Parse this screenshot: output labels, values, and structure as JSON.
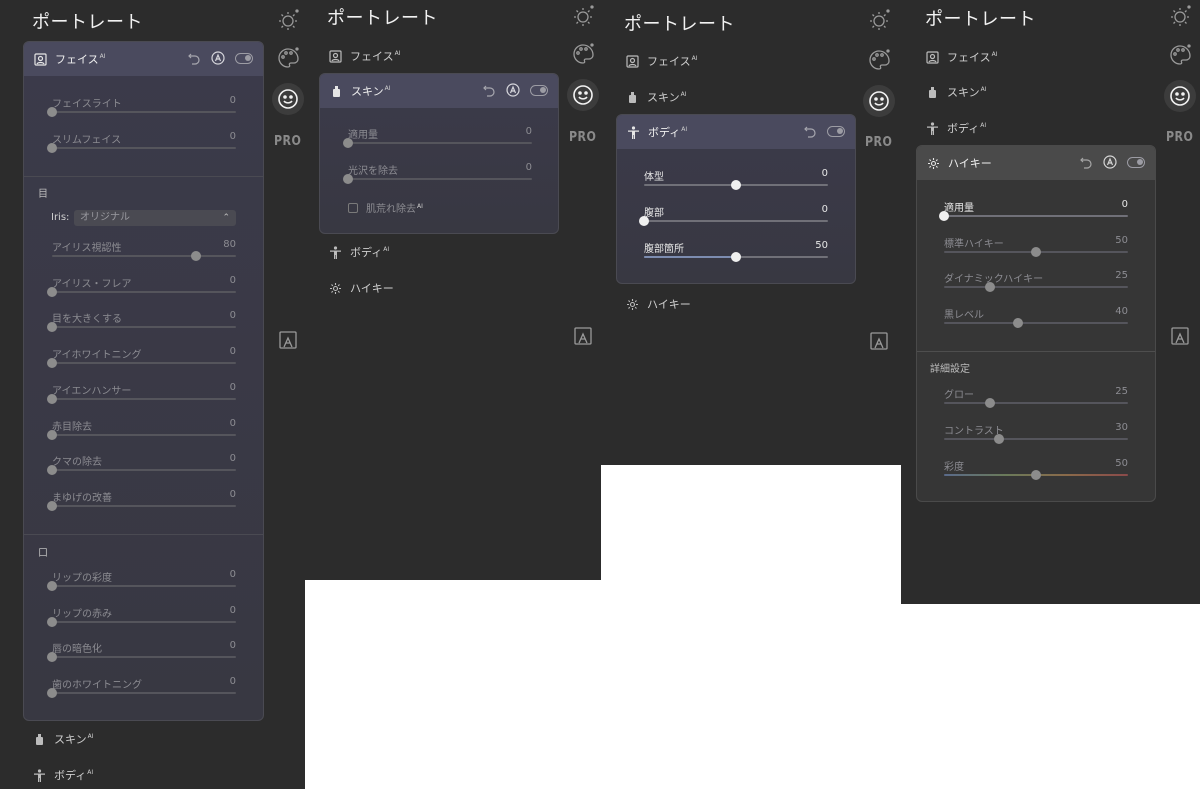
{
  "title": "ポートレート",
  "ai_mark": "AI",
  "pro_label": "PRO",
  "tools": [
    "sun-icon",
    "palette-icon",
    "smiley-icon",
    "pro-label",
    "portrait-frame-icon"
  ],
  "sections": {
    "face": "フェイス",
    "skin": "スキン",
    "body": "ボディ",
    "highkey": "ハイキー"
  },
  "face_panel": {
    "face_sliders": [
      {
        "label": "フェイスライト",
        "value": "0",
        "pct": 0
      },
      {
        "label": "スリムフェイス",
        "value": "0",
        "pct": 0
      }
    ],
    "eye_section": "目",
    "iris_label": "Iris:",
    "iris_value": "オリジナル",
    "eye_sliders": [
      {
        "label": "アイリス視認性",
        "value": "80",
        "pct": 0.78
      },
      {
        "label": "アイリス・フレア",
        "value": "0",
        "pct": 0
      },
      {
        "label": "目を大きくする",
        "value": "0",
        "pct": 0
      },
      {
        "label": "アイホワイトニング",
        "value": "0",
        "pct": 0
      },
      {
        "label": "アイエンハンサー",
        "value": "0",
        "pct": 0
      },
      {
        "label": "赤目除去",
        "value": "0",
        "pct": 0
      },
      {
        "label": "クマの除去",
        "value": "0",
        "pct": 0
      },
      {
        "label": "まゆげの改善",
        "value": "0",
        "pct": 0
      }
    ],
    "mouth_section": "口",
    "mouth_sliders": [
      {
        "label": "リップの彩度",
        "value": "0",
        "pct": 0
      },
      {
        "label": "リップの赤み",
        "value": "0",
        "pct": 0
      },
      {
        "label": "唇の暗色化",
        "value": "0",
        "pct": 0
      },
      {
        "label": "歯のホワイトニング",
        "value": "0",
        "pct": 0
      }
    ]
  },
  "skin_panel": {
    "sliders": [
      {
        "label": "適用量",
        "value": "0",
        "pct": 0
      },
      {
        "label": "光沢を除去",
        "value": "0",
        "pct": 0
      }
    ],
    "checkbox_label": "肌荒れ除去"
  },
  "body_panel": {
    "sliders": [
      {
        "label": "体型",
        "value": "0",
        "pct": 0.5
      },
      {
        "label": "腹部",
        "value": "0",
        "pct": 0
      },
      {
        "label": "腹部箇所",
        "value": "50",
        "pct": 0.5
      }
    ]
  },
  "highkey_panel": {
    "sliders": [
      {
        "label": "適用量",
        "value": "0",
        "pct": 0
      },
      {
        "label": "標準ハイキー",
        "value": "50",
        "pct": 0.5
      },
      {
        "label": "ダイナミックハイキー",
        "value": "25",
        "pct": 0.25
      },
      {
        "label": "黒レベル",
        "value": "40",
        "pct": 0.4
      }
    ],
    "advanced_section": "詳細設定",
    "advanced_sliders": [
      {
        "label": "グロー",
        "value": "25",
        "pct": 0.25
      },
      {
        "label": "コントラスト",
        "value": "30",
        "pct": 0.3
      },
      {
        "label": "彩度",
        "value": "50",
        "pct": 0.5
      }
    ]
  }
}
